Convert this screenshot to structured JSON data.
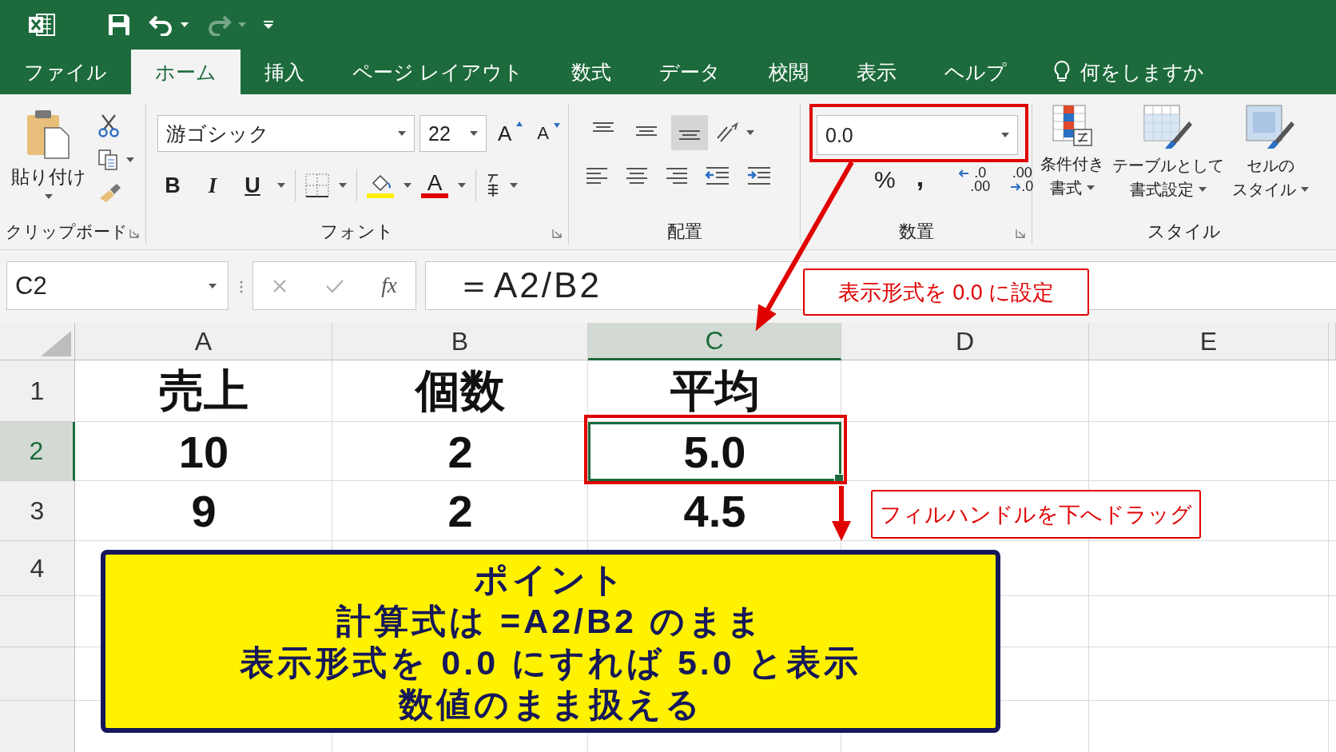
{
  "quick_access": [
    {
      "kind": "save",
      "disabled": false
    },
    {
      "kind": "undo",
      "disabled": false
    },
    {
      "kind": "redo",
      "disabled": true
    },
    {
      "kind": "customize",
      "disabled": false
    }
  ],
  "menu_tabs": [
    {
      "label": "ファイル",
      "selected": false
    },
    {
      "label": "ホーム",
      "selected": true
    },
    {
      "label": "挿入",
      "selected": false
    },
    {
      "label": "ページ レイアウト",
      "selected": false
    },
    {
      "label": "数式",
      "selected": false
    },
    {
      "label": "データ",
      "selected": false
    },
    {
      "label": "校閲",
      "selected": false
    },
    {
      "label": "表示",
      "selected": false
    },
    {
      "label": "ヘルプ",
      "selected": false
    }
  ],
  "tell_me": "何をしますか",
  "clipboard": {
    "paste": "貼り付け",
    "group_label": "クリップボード"
  },
  "font": {
    "name": "游ゴシック",
    "size": "22",
    "grow": "A",
    "shrink": "A",
    "bold": "B",
    "italic": "I",
    "underline": "U",
    "font_color": "A",
    "group_label": "フォント"
  },
  "alignment": {
    "vertical": [
      {
        "selected": false
      },
      {
        "selected": false
      },
      {
        "selected": true
      }
    ],
    "group_label": "配置"
  },
  "number": {
    "format": "0.0",
    "percent": "%",
    "comma": ",",
    "increase_decimal": [
      ".0",
      ".00"
    ],
    "decrease_decimal": [
      ".00",
      ".0"
    ],
    "group_label": "数置"
  },
  "styles": {
    "buttons": [
      {
        "lines": [
          "条件付き",
          "書式"
        ]
      },
      {
        "lines": [
          "テーブルとして",
          "書式設定"
        ]
      },
      {
        "lines": [
          "セルの",
          "スタイル"
        ]
      }
    ],
    "group_label": "スタイル"
  },
  "formula_bar": {
    "name_box": "C2",
    "function_label": "fx",
    "formula": "＝A2/B2"
  },
  "sheet": {
    "columns": [
      {
        "label": "A",
        "selected": false
      },
      {
        "label": "B",
        "selected": false
      },
      {
        "label": "C",
        "selected": true
      },
      {
        "label": "D",
        "selected": false
      },
      {
        "label": "E",
        "selected": false
      }
    ],
    "rows": [
      {
        "number": "1",
        "selected": false,
        "cells": [
          "売上",
          "個数",
          "平均"
        ]
      },
      {
        "number": "2",
        "selected": true,
        "cells": [
          "10",
          "2",
          "5.0"
        ]
      },
      {
        "number": "3",
        "selected": false,
        "cells": [
          "9",
          "2",
          "4.5"
        ]
      },
      {
        "number": "4",
        "selected": false
      }
    ]
  },
  "annotations": {
    "format_callout": "表示形式を 0.0 に設定",
    "fill_callout": "フィルハンドルを下へドラッグ",
    "point_box": {
      "title": "ポイント",
      "lines": [
        "計算式は =A2/B2 のまま",
        "表示形式を 0.0 にすれば 5.0 と表示",
        "数値のまま扱える"
      ]
    }
  }
}
